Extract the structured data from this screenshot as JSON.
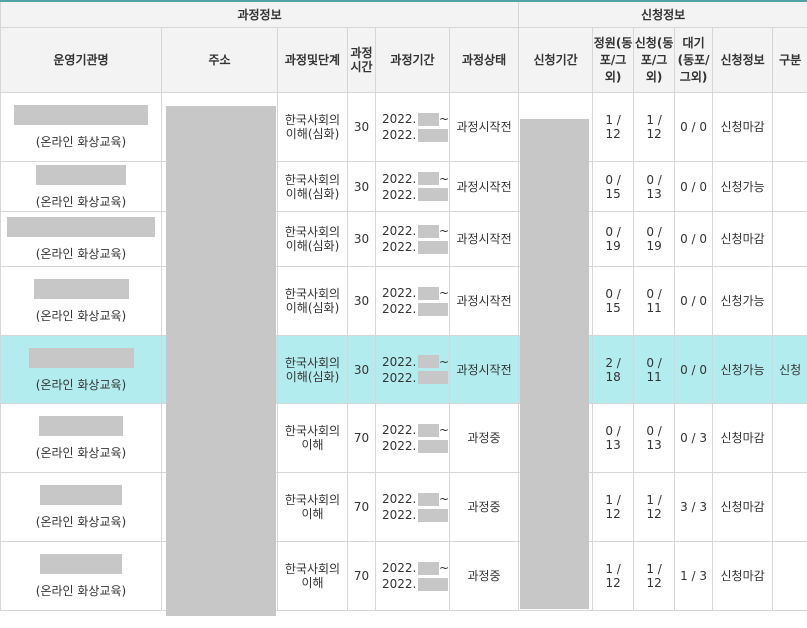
{
  "header": {
    "group_course": "과정정보",
    "group_apply": "신청정보",
    "columns": {
      "institution": "운영기관명",
      "address": "주소",
      "stage": "과정및단계",
      "hours": "과정시간",
      "period": "과정기간",
      "status": "과정상태",
      "apply_period": "신청기간",
      "capacity": "정원(동포/그외)",
      "applied": "신청(동포/그외)",
      "waiting": "대기(동포/그외)",
      "apply_info": "신청정보",
      "category": "구분"
    }
  },
  "rows": [
    {
      "institution_type": "(온라인 화상교육)",
      "stage": "한국사회의\n이해(심화)",
      "hours": "30",
      "period_start": "2022.",
      "period_sep": "~",
      "period_end": "2022.",
      "status": "과정시작전",
      "capacity": "1 /\n12",
      "applied": "1 /\n12",
      "waiting": "0 / 0",
      "apply_info": "신청마감",
      "category": ""
    },
    {
      "institution_type": "(온라인 화상교육)",
      "stage": "한국사회의\n이해(심화)",
      "hours": "30",
      "period_start": "2022.",
      "period_sep": "~",
      "period_end": "2022.",
      "status": "과정시작전",
      "capacity": "0 /\n15",
      "applied": "0 /\n13",
      "waiting": "0 / 0",
      "apply_info": "신청가능",
      "category": ""
    },
    {
      "institution_type": "(온라인 화상교육)",
      "stage": "한국사회의\n이해(심화)",
      "hours": "30",
      "period_start": "2022.",
      "period_sep": "~",
      "period_end": "2022.",
      "status": "과정시작전",
      "capacity": "0 /\n19",
      "applied": "0 /\n19",
      "waiting": "0 / 0",
      "apply_info": "신청마감",
      "category": ""
    },
    {
      "institution_type": "(온라인 화상교육)",
      "stage": "한국사회의\n이해(심화)",
      "hours": "30",
      "period_start": "2022.",
      "period_sep": "~",
      "period_end": "2022.",
      "status": "과정시작전",
      "capacity": "0 /\n15",
      "applied": "0 /\n11",
      "waiting": "0 / 0",
      "apply_info": "신청가능",
      "category": ""
    },
    {
      "institution_type": "(온라인 화상교육)",
      "stage": "한국사회의\n이해(심화)",
      "hours": "30",
      "period_start": "2022.",
      "period_sep": "~",
      "period_end": "2022.",
      "status": "과정시작전",
      "capacity": "2 /\n18",
      "applied": "0 /\n11",
      "waiting": "0 / 0",
      "apply_info": "신청가능",
      "category": "신청"
    },
    {
      "institution_type": "(온라인 화상교육)",
      "stage": "한국사회의\n이해",
      "hours": "70",
      "period_start": "2022.",
      "period_sep": "~",
      "period_end": "2022.",
      "status": "과정중",
      "capacity": "0 /\n13",
      "applied": "0 /\n13",
      "waiting": "0 / 3",
      "apply_info": "신청마감",
      "category": ""
    },
    {
      "institution_type": "(온라인 화상교육)",
      "stage": "한국사회의\n이해",
      "hours": "70",
      "period_start": "2022.",
      "period_sep": "~",
      "period_end": "2022.",
      "status": "과정중",
      "capacity": "1 /\n12",
      "applied": "1 /\n12",
      "waiting": "3 / 3",
      "apply_info": "신청마감",
      "category": ""
    },
    {
      "institution_type": "(온라인 화상교육)",
      "stage": "한국사회의\n이해",
      "hours": "70",
      "period_start": "2022.",
      "period_sep": "~",
      "period_end": "2022.",
      "status": "과정중",
      "capacity": "1 /\n12",
      "applied": "1 /\n12",
      "waiting": "1 / 3",
      "apply_info": "신청마감",
      "category": ""
    }
  ]
}
